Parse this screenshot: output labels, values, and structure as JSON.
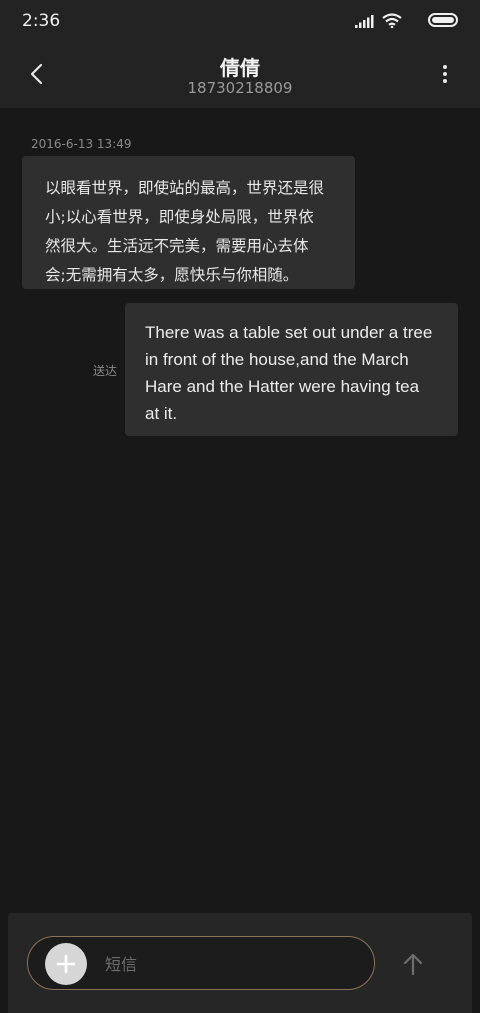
{
  "status_bar": {
    "time": "2:36",
    "icons": [
      "signal-icon",
      "wifi-icon",
      "battery-icon"
    ]
  },
  "header": {
    "back_icon": "chevron-left-icon",
    "contact_name": "倩倩",
    "contact_number": "18730218809",
    "menu_icon": "more-vertical-icon"
  },
  "conversation": {
    "timestamp": "2016-6-13 13:49",
    "messages": [
      {
        "direction": "incoming",
        "lines": [
          "以眼看世界，即使站的最高，世界还是很",
          "小;以心看世界，即使身处局限，世界依",
          "然很大。生活远不完美，需要用心去体",
          "会;无需拥有太多，愿快乐与你相随。"
        ]
      },
      {
        "direction": "outgoing",
        "lines": [
          "There was a table set out under a tree",
          "in front of the house,and the March",
          "Hare and the Hatter were having tea",
          "at it."
        ],
        "status": "送达"
      }
    ]
  },
  "composer": {
    "add_icon": "plus-icon",
    "placeholder": "短信",
    "value": "",
    "send_icon": "arrow-up-icon"
  },
  "colors": {
    "background": "#181818",
    "bar": "#232323",
    "bubble": "#2f2f2f",
    "input_border": "#8a7457"
  }
}
